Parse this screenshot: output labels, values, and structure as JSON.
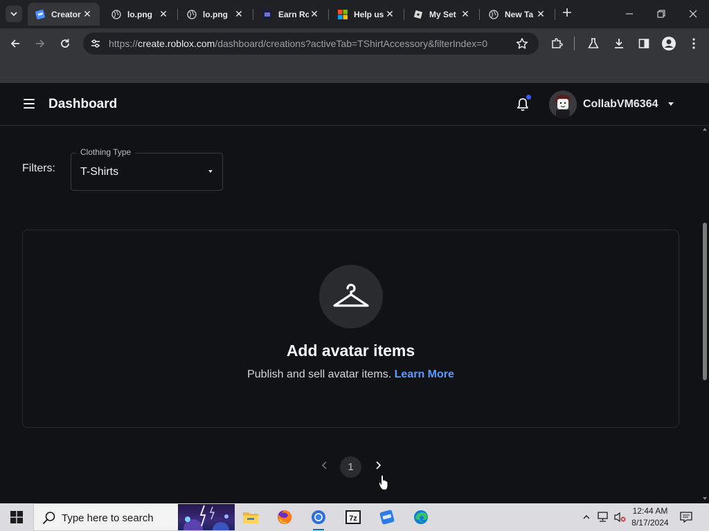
{
  "browser": {
    "tabs": [
      {
        "title": "Creator",
        "active": true,
        "favicon": "roblox-studio-icon"
      },
      {
        "title": "lo.png",
        "active": false,
        "favicon": "globe-icon"
      },
      {
        "title": "lo.png",
        "active": false,
        "favicon": "globe-icon"
      },
      {
        "title": "Earn Ro",
        "active": false,
        "favicon": "earn-site-icon"
      },
      {
        "title": "Help us",
        "active": false,
        "favicon": "microsoft-icon"
      },
      {
        "title": "My Set",
        "active": false,
        "favicon": "roblox-icon"
      },
      {
        "title": "New Ta",
        "active": false,
        "favicon": "globe-icon"
      }
    ],
    "url_prefix": "https://",
    "url_host": "create.roblox.com",
    "url_path": "/dashboard/creations?activeTab=TShirtAccessory&filterIndex=0"
  },
  "app": {
    "title": "Dashboard",
    "username": "CollabVM6364",
    "has_notification": true
  },
  "filters": {
    "label": "Filters:",
    "clothing_type_legend": "Clothing Type",
    "clothing_type_value": "T-Shirts"
  },
  "empty_state": {
    "icon": "hanger-icon",
    "title": "Add avatar items",
    "subtitle": "Publish and sell avatar items.",
    "link": "Learn More"
  },
  "pagination": {
    "current_page": "1"
  },
  "taskbar": {
    "search_placeholder": "Type here to search",
    "time": "12:44 AM",
    "date": "8/17/2024"
  },
  "colors": {
    "page_bg": "#111216",
    "link": "#5a9bff",
    "notification_dot": "#335fff"
  }
}
